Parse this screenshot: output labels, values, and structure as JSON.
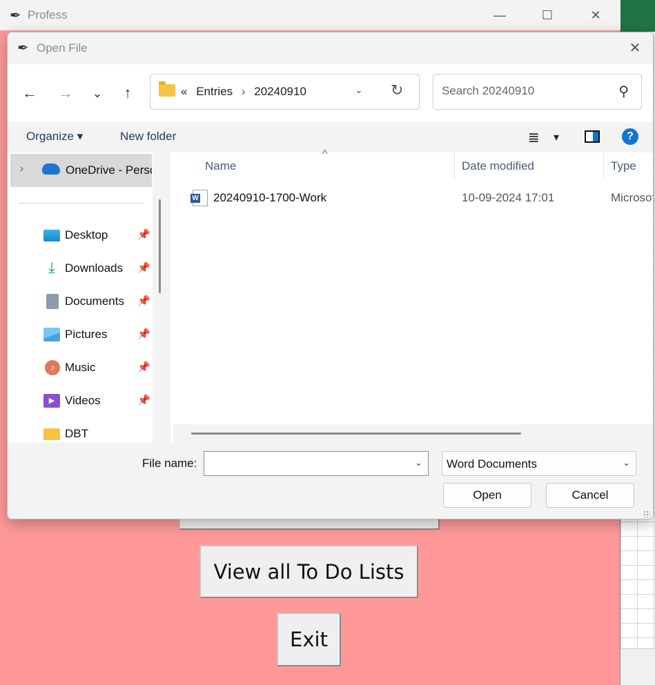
{
  "main_window": {
    "title": "Profess",
    "controls": {
      "minimize": "—",
      "maximize": "☐",
      "close": "✕"
    },
    "buttons": {
      "view_all": "View all To Do Lists",
      "exit": "Exit"
    },
    "colors": {
      "background": "#ff9999"
    }
  },
  "dialog": {
    "title": "Open File",
    "close": "✕",
    "nav": {
      "back": "←",
      "forward": "→",
      "recent": "⌄",
      "up": "↑",
      "breadcrumb_prefix": "«",
      "breadcrumb": [
        "Entries",
        "20240910"
      ],
      "separator": "›",
      "address_dropdown": "⌄",
      "refresh": "↻"
    },
    "search": {
      "placeholder": "Search 20240910",
      "icon": "search-icon"
    },
    "command_bar": {
      "organize": "Organize ▾",
      "new_folder": "New folder",
      "view_icon": "≣",
      "view_dropdown": "▾",
      "help": "?"
    },
    "navigation_pane": {
      "selected": {
        "chevron": "›",
        "label": "OneDrive - Personal"
      },
      "items": [
        {
          "label": "Desktop",
          "icon": "desktop-icon",
          "pinned": true
        },
        {
          "label": "Downloads",
          "icon": "download-icon",
          "pinned": true
        },
        {
          "label": "Documents",
          "icon": "documents-icon",
          "pinned": true
        },
        {
          "label": "Pictures",
          "icon": "pictures-icon",
          "pinned": true
        },
        {
          "label": "Music",
          "icon": "music-icon",
          "pinned": true
        },
        {
          "label": "Videos",
          "icon": "videos-icon",
          "pinned": true
        },
        {
          "label": "DBT",
          "icon": "folder-icon",
          "pinned": false
        }
      ],
      "pin_glyph": "📌"
    },
    "file_list": {
      "columns": [
        "Name",
        "Date modified",
        "Type"
      ],
      "sort_indicator": "^",
      "rows": [
        {
          "name": "20240910-1700-Work",
          "date_modified": "10-09-2024 17:01",
          "type": "Microsoft Word Document"
        }
      ]
    },
    "bottom": {
      "file_name_label": "File name:",
      "file_name_value": "",
      "dropdown_glyph": "⌄",
      "file_type": "Word Documents",
      "open": "Open",
      "cancel": "Cancel"
    }
  }
}
